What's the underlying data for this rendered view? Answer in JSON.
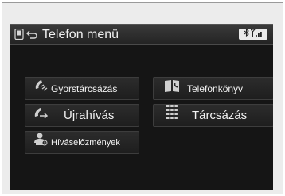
{
  "header": {
    "title": "Telefon menü",
    "phone_icon": "phone-icon",
    "back_icon": "back-icon",
    "status": {
      "bluetooth_icon": "bluetooth-icon",
      "signal_icon": "signal-icon"
    }
  },
  "menu": {
    "speed_dial": {
      "label": "Gyorstárcsázás",
      "icon": "speed-dial-icon"
    },
    "phonebook": {
      "label": "Telefonkönyv",
      "icon": "phonebook-icon"
    },
    "redial": {
      "label": "Újrahívás",
      "icon": "redial-icon"
    },
    "dial": {
      "label": "Tárcsázás",
      "icon": "keypad-icon"
    },
    "call_history": {
      "label": "Híváselőzmények",
      "icon": "call-history-icon"
    }
  },
  "colors": {
    "screen_bg": "#151515",
    "button_bg": "#262626",
    "text": "#f2f2f2",
    "frame": "#ececec"
  }
}
